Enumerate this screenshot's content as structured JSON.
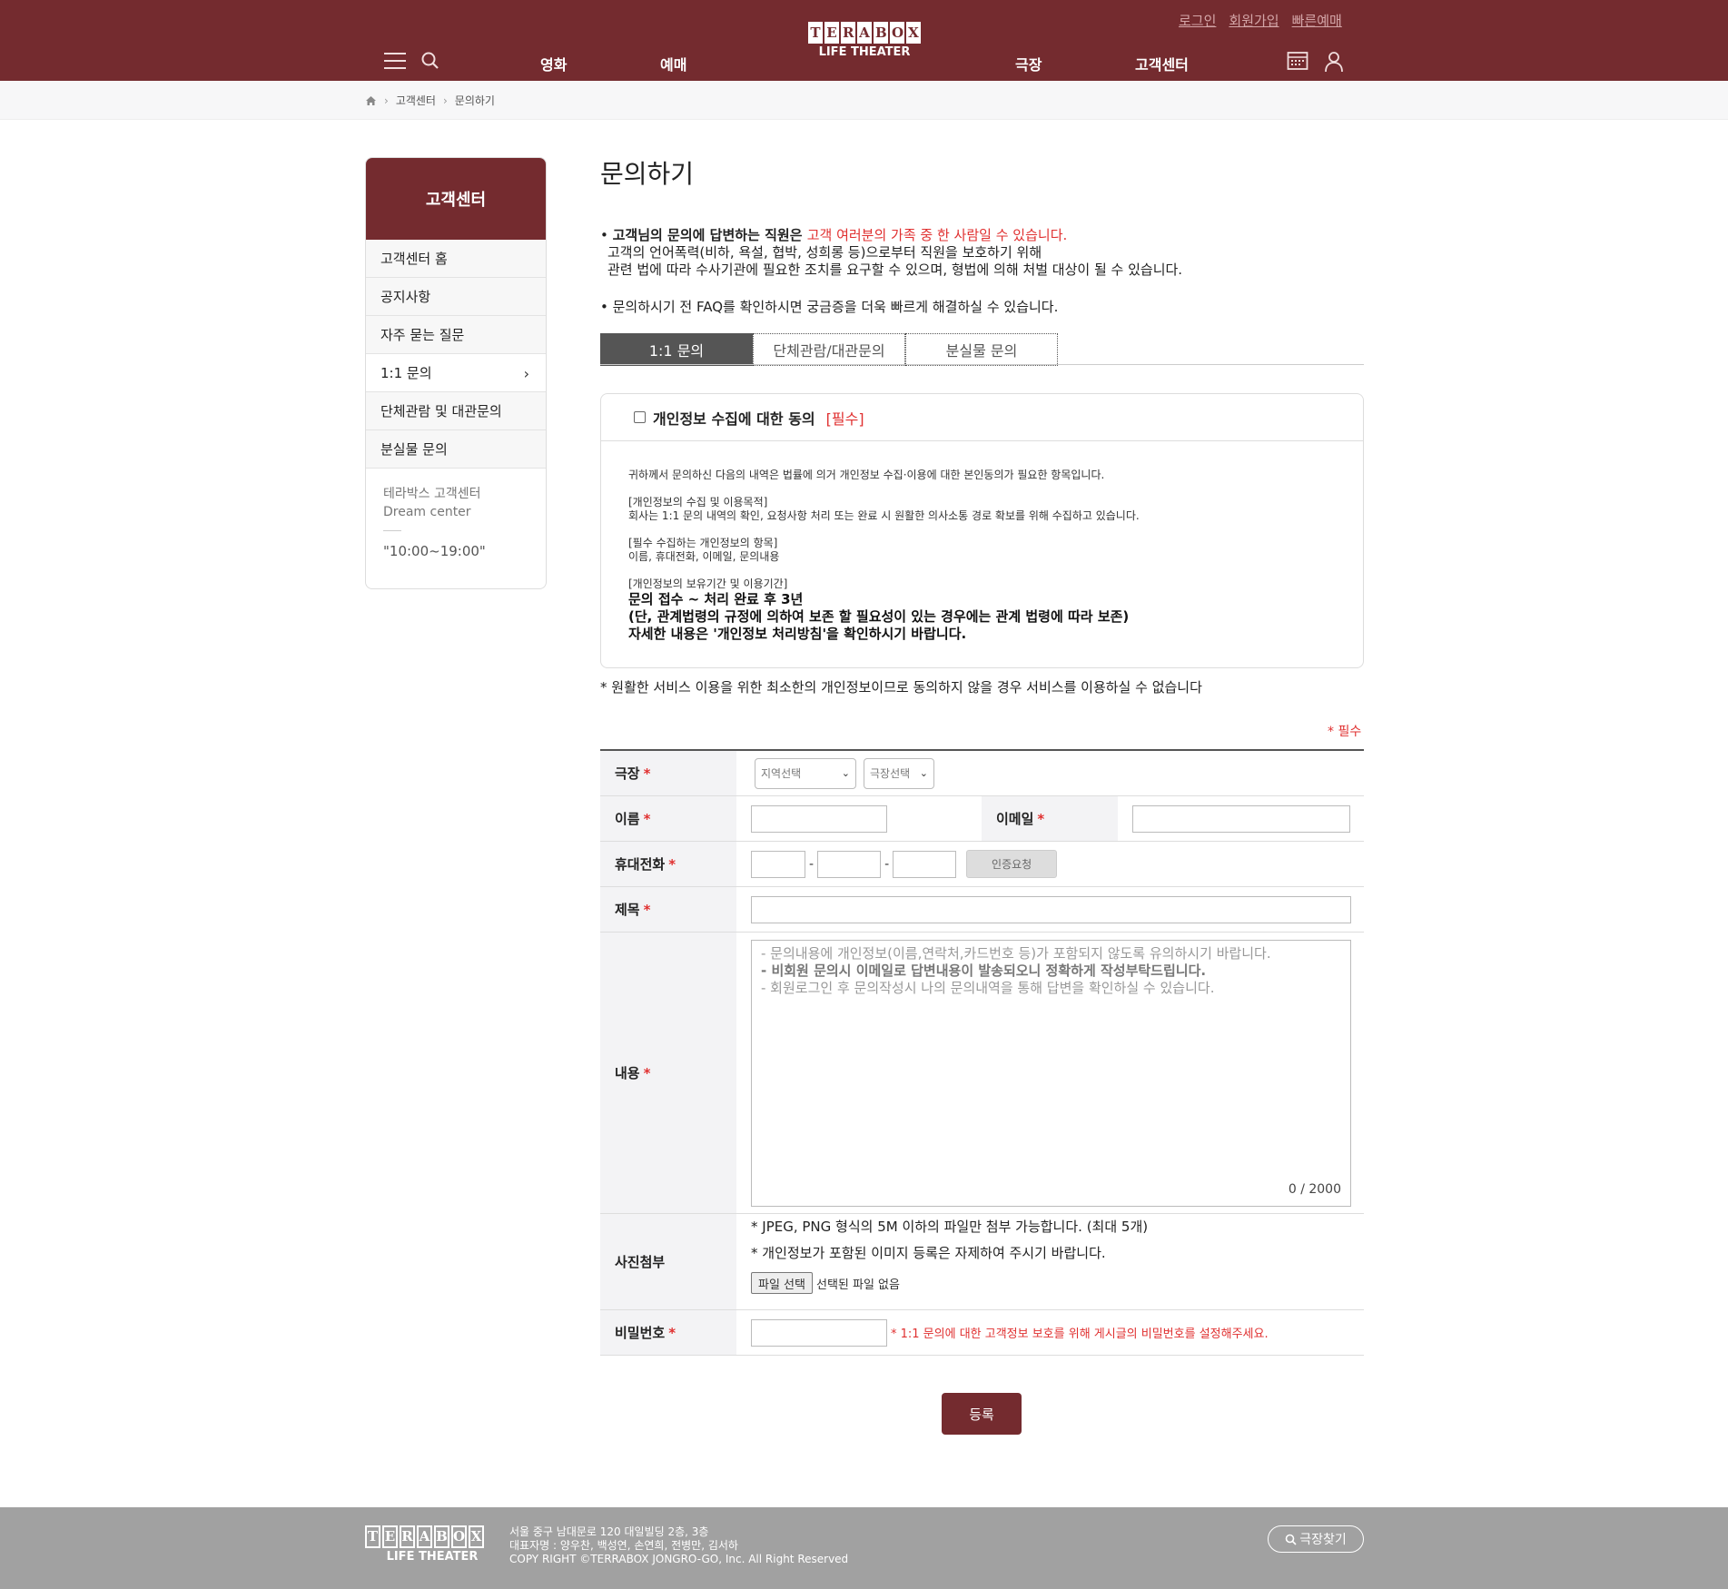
{
  "header": {
    "top_links": [
      "로그인",
      "회원가입",
      "빠른예매"
    ],
    "nav_left": [
      "영화",
      "예매"
    ],
    "nav_right": [
      "극장",
      "고객센터"
    ],
    "logo_letters": [
      "T",
      "E",
      "R",
      "A",
      "B",
      "O",
      "X"
    ],
    "logo_sub": "LIFE THEATER"
  },
  "breadcrumb": [
    "고객센터",
    "문의하기"
  ],
  "sidebar": {
    "title": "고객센터",
    "items": [
      "고객센터 홈",
      "공지사항",
      "자주 묻는 질문",
      "1:1 문의",
      "단체관람 및 대관문의",
      "분실물 문의"
    ],
    "active_index": 3,
    "info_name": "테라박스 고객센터",
    "info_sub": "Dream center",
    "hours": "\"10:00~19:00\""
  },
  "main": {
    "title": "문의하기",
    "notice_1a": "고객님의 문의에 답변하는 직원은 ",
    "notice_1b": "고객 여러분의 가족 중 한 사람일 수 있습니다.",
    "notice_2": "고객의 언어폭력(비하, 욕설, 협박, 성희롱 등)으로부터 직원을 보호하기 위해",
    "notice_3": "관련 법에 따라 수사기관에 필요한 조치를 요구할 수 있으며, 형법에 의해 처벌 대상이 될 수 있습니다.",
    "notice_4": "문의하시기 전 FAQ를 확인하시면 궁금증을 더욱 빠르게 해결하실 수 있습니다.",
    "tabs": [
      "1:1 문의",
      "단체관람/대관문의",
      "분실물 문의"
    ]
  },
  "consent": {
    "label": "개인정보 수집에 대한 동의",
    "required": "[필수]",
    "intro": "귀하께서 문의하신 다음의 내역은 법률에 의거 개인정보 수집·이용에 대한 본인동의가 필요한 항목입니다.",
    "purpose_title": "[개인정보의 수집 및 이용목적]",
    "purpose_text": "회사는 1:1 문의 내역의 확인, 요청사항 처리 또는 완료 시 원활한 의사소통 경로 확보를 위해 수집하고 있습니다.",
    "items_title": "[필수 수집하는 개인정보의 항목]",
    "items_text": "이름, 휴대전화, 이메일, 문의내용",
    "period_title": "[개인정보의 보유기간 및 이용기간]",
    "period_1": "문의 접수 ~ 처리 완료 후 3년",
    "period_2": "(단, 관계법령의 규정에 의하여 보존 할 필요성이 있는 경우에는 관계 법령에 따라 보존)",
    "period_3": "자세한 내용은 '개인정보 처리방침'을 확인하시기 바랍니다.",
    "note": "* 원활한 서비스 이용을 위한 최소한의 개인정보이므로 동의하지 않을 경우 서비스를 이용하실 수 없습니다"
  },
  "form": {
    "required_mark": "* 필수",
    "theater_label": "극장",
    "region_select": "지역선택",
    "theater_select": "극장선택",
    "name_label": "이름",
    "email_label": "이메일",
    "phone_label": "휴대전화",
    "cert_button": "인증요청",
    "subject_label": "제목",
    "content_label": "내용",
    "content_placeholder_1": "- 문의내용에 개인정보(이름,연락처,카드번호 등)가 포함되지 않도록 유의하시기 바랍니다.",
    "content_placeholder_2": "- 비회원 문의시 이메일로 답변내용이 발송되오니 정확하게 작성부탁드립니다.",
    "content_placeholder_3": "- 회원로그인 후 문의작성시 나의 문의내역을 통해 답변을 확인하실 수 있습니다.",
    "counter": "0 / 2000",
    "photo_label": "사진첨부",
    "photo_note_1": "* JPEG, PNG 형식의 5M 이하의 파일만 첨부 가능합니다. (최대 5개)",
    "photo_note_2": "* 개인정보가 포함된 이미지 등록은 자제하여 주시기 바랍니다.",
    "file_button": "파일 선택",
    "file_status": "선택된 파일 없음",
    "password_label": "비밀번호",
    "password_note": "* 1:1 문의에 대한 고객정보 보호를 위해 게시글의 비밀번호를 설정해주세요.",
    "submit": "등록",
    "star": "*"
  },
  "footer": {
    "address": "서울 중구 남대문로 120 대일빌딩 2층, 3층",
    "ceo": "대표자명 : 양우찬, 백성연, 손연희, 전병만, 김서하",
    "copyright": "COPY RIGHT ©TERRABOX JONGRO-GO, Inc. All Right Reserved",
    "find_theater": "극장찾기"
  },
  "colors": {
    "brand": "#742b2f",
    "required": "#e03030"
  }
}
